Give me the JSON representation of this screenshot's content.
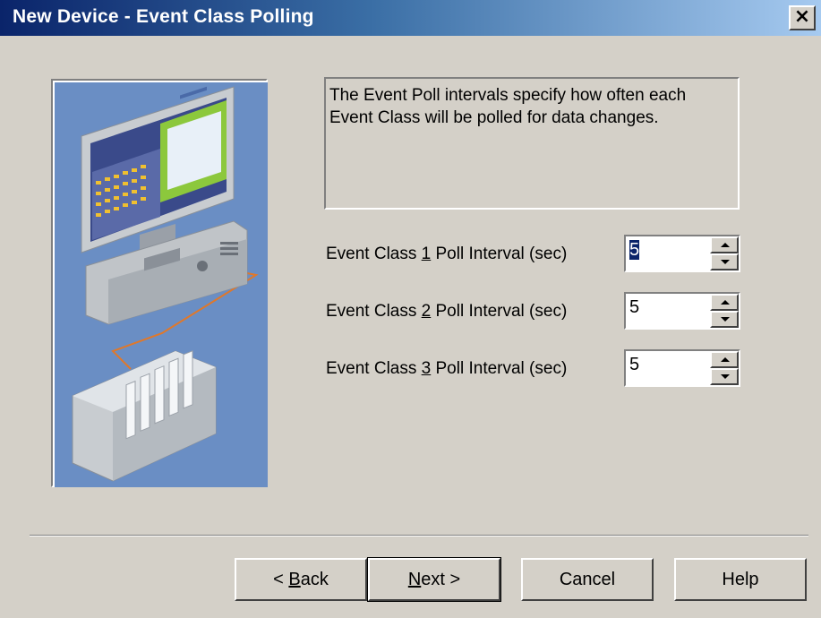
{
  "window": {
    "title": "New Device - Event Class Polling",
    "close_glyph": "×"
  },
  "description": "The Event Poll intervals specify how often each Event Class will be polled for data changes.",
  "fields": [
    {
      "label_pre": "Event Class ",
      "label_key": "1",
      "label_post": " Poll Interval (sec)",
      "value": "5"
    },
    {
      "label_pre": "Event Class ",
      "label_key": "2",
      "label_post": " Poll Interval (sec)",
      "value": "5"
    },
    {
      "label_pre": "Event Class ",
      "label_key": "3",
      "label_post": " Poll Interval (sec)",
      "value": "5"
    }
  ],
  "buttons": {
    "back_arrow": "< ",
    "back_key": "B",
    "back_rest": "ack",
    "next_key": "N",
    "next_rest": "ext >",
    "cancel": "Cancel",
    "help": "Help"
  },
  "colors": {
    "dialog_bg": "#d4d0c8",
    "title_start": "#0a246a",
    "title_end": "#a6caf0",
    "illustration_bg": "#6a8ec4"
  },
  "icons": {
    "illustration": "computer-and-plc-illustration"
  }
}
